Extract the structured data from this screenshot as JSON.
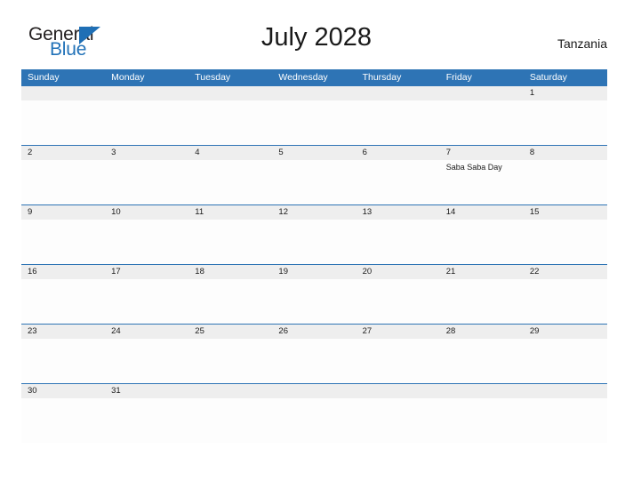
{
  "brand": {
    "name_part1": "General",
    "name_part2": "Blue",
    "triangle_color": "#1f6fb5",
    "blue_text_color": "#2272b8",
    "dark_text_color": "#231f20"
  },
  "header": {
    "title": "July 2028",
    "country": "Tanzania"
  },
  "theme": {
    "header_blue": "#2e74b5",
    "date_band_gray": "#eeeeee",
    "cell_white": "#fdfdfd",
    "separator_blue": "#2e74b5",
    "text_color": "#1a1a1a"
  },
  "calendar": {
    "month": "July",
    "year": "2028",
    "weekday_headers": [
      "Sunday",
      "Monday",
      "Tuesday",
      "Wednesday",
      "Thursday",
      "Friday",
      "Saturday"
    ],
    "weeks": [
      {
        "days": [
          {
            "num": "",
            "events": []
          },
          {
            "num": "",
            "events": []
          },
          {
            "num": "",
            "events": []
          },
          {
            "num": "",
            "events": []
          },
          {
            "num": "",
            "events": []
          },
          {
            "num": "",
            "events": []
          },
          {
            "num": "1",
            "events": []
          }
        ]
      },
      {
        "days": [
          {
            "num": "2",
            "events": []
          },
          {
            "num": "3",
            "events": []
          },
          {
            "num": "4",
            "events": []
          },
          {
            "num": "5",
            "events": []
          },
          {
            "num": "6",
            "events": []
          },
          {
            "num": "7",
            "events": [
              "Saba Saba Day"
            ]
          },
          {
            "num": "8",
            "events": []
          }
        ]
      },
      {
        "days": [
          {
            "num": "9",
            "events": []
          },
          {
            "num": "10",
            "events": []
          },
          {
            "num": "11",
            "events": []
          },
          {
            "num": "12",
            "events": []
          },
          {
            "num": "13",
            "events": []
          },
          {
            "num": "14",
            "events": []
          },
          {
            "num": "15",
            "events": []
          }
        ]
      },
      {
        "days": [
          {
            "num": "16",
            "events": []
          },
          {
            "num": "17",
            "events": []
          },
          {
            "num": "18",
            "events": []
          },
          {
            "num": "19",
            "events": []
          },
          {
            "num": "20",
            "events": []
          },
          {
            "num": "21",
            "events": []
          },
          {
            "num": "22",
            "events": []
          }
        ]
      },
      {
        "days": [
          {
            "num": "23",
            "events": []
          },
          {
            "num": "24",
            "events": []
          },
          {
            "num": "25",
            "events": []
          },
          {
            "num": "26",
            "events": []
          },
          {
            "num": "27",
            "events": []
          },
          {
            "num": "28",
            "events": []
          },
          {
            "num": "29",
            "events": []
          }
        ]
      },
      {
        "days": [
          {
            "num": "30",
            "events": []
          },
          {
            "num": "31",
            "events": []
          },
          {
            "num": "",
            "events": []
          },
          {
            "num": "",
            "events": []
          },
          {
            "num": "",
            "events": []
          },
          {
            "num": "",
            "events": []
          },
          {
            "num": "",
            "events": []
          }
        ]
      }
    ]
  }
}
